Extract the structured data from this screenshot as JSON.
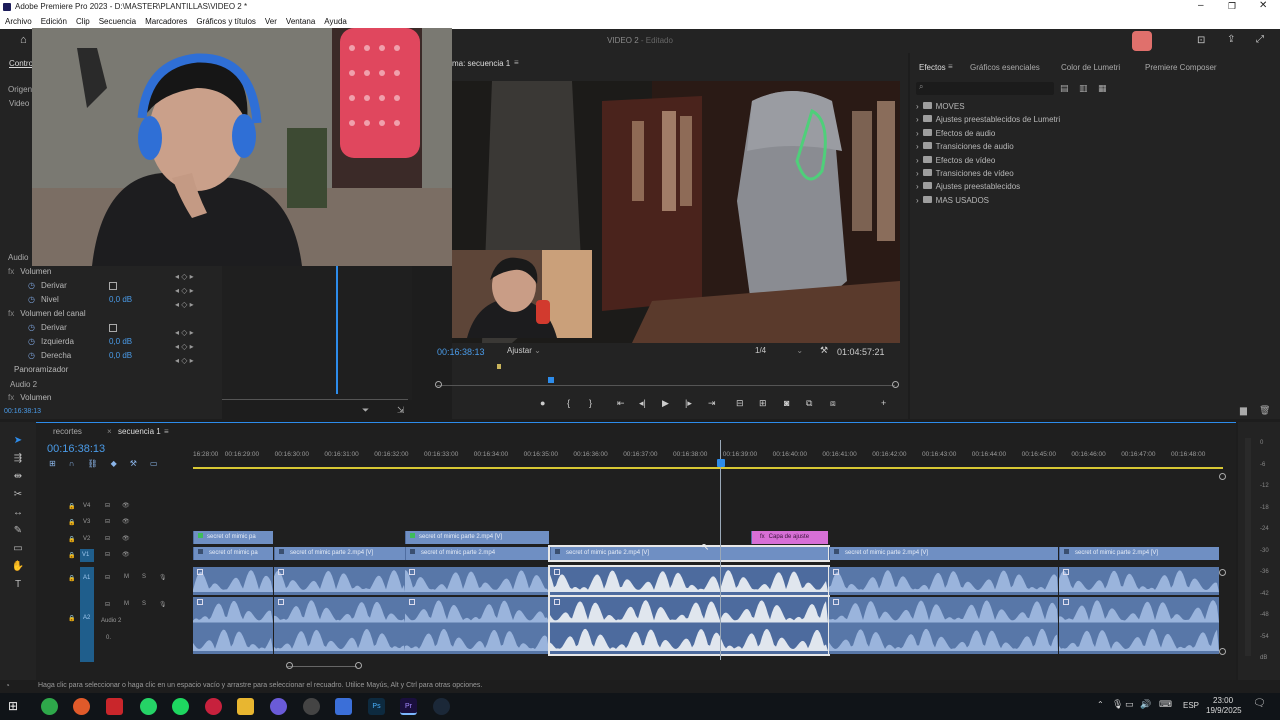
{
  "window": {
    "title": "Adobe Premiere Pro 2023 - D:\\MASTER\\PLANTILLAS\\VIDEO 2 *",
    "project": "VIDEO 2",
    "status": "Editado"
  },
  "menu": [
    "Archivo",
    "Edición",
    "Clip",
    "Secuencia",
    "Marcadores",
    "Gráficos y títulos",
    "Ver",
    "Ventana",
    "Ayuda"
  ],
  "left_panel": {
    "tab_controls": "Contro",
    "origen": "Origen",
    "video": "Video",
    "audio_section": "Audio",
    "audio2": "Audio 2",
    "rows": [
      {
        "label": "Volumen",
        "type": "fx"
      },
      {
        "label": "Derivar",
        "value": ""
      },
      {
        "label": "Nivel",
        "value": "0,0 dB"
      },
      {
        "label": "Volumen del canal",
        "type": "fx"
      },
      {
        "label": "Derivar",
        "value": ""
      },
      {
        "label": "Izquierda",
        "value": "0,0 dB"
      },
      {
        "label": "Derecha",
        "value": "0,0 dB"
      },
      {
        "label": "Panoramizador",
        "type": "fx"
      },
      {
        "label": "Volumen",
        "type": "fx2"
      }
    ],
    "timecode": "00:16:38:13"
  },
  "program": {
    "title": "ma: secuencia 1",
    "timecode": "00:16:38:13",
    "fit": "Ajustar",
    "resolution": "1/4",
    "duration": "01:04:57:21"
  },
  "effects": {
    "tabs": [
      "Efectos",
      "Gráficos esenciales",
      "Color de Lumetri",
      "Premiere Composer"
    ],
    "items": [
      "MOVES",
      "Ajustes preestablecidos de Lumetri",
      "Efectos de audio",
      "Transiciones de audio",
      "Efectos de vídeo",
      "Transiciones de vídeo",
      "Ajustes preestablecidos",
      "MAS USADOS"
    ]
  },
  "timeline": {
    "tabs": [
      "recortes",
      "secuencia 1"
    ],
    "timecode": "00:16:38:13",
    "ruler": [
      "16:28:00",
      "00:16:29:00",
      "00:16:30:00",
      "00:16:31:00",
      "00:16:32:00",
      "00:16:33:00",
      "00:16:34:00",
      "00:16:35:00",
      "00:16:36:00",
      "00:16:37:00",
      "00:16:38:00",
      "00:16:39:00",
      "00:16:40:00",
      "00:16:41:00",
      "00:16:42:00",
      "00:16:43:00",
      "00:16:44:00",
      "00:16:45:00",
      "00:16:46:00",
      "00:16:47:00",
      "00:16:48:00"
    ],
    "tracks": [
      "V4",
      "V3",
      "V2",
      "V1",
      "A1",
      "A2"
    ],
    "audio2_label": "Audio 2",
    "audio2_value": "0.",
    "clips_v2": [
      "secret of mimic pa",
      "secret of mimic parte 2.mp4 [V]",
      "Capa de ajuste"
    ],
    "clips_v1": [
      "secret of mimic pa",
      "secret of mimic parte 2.mp4 [V]",
      "secret of mimic parte 2.mp4",
      "secret of mimic parte 2.mp4 [V]",
      "secret of mimic parte 2.mp4 [V]",
      "secret of mimic parte 2.mp4 [V]"
    ],
    "meter": [
      "0",
      "-6",
      "-12",
      "-18",
      "-24",
      "-30",
      "-36",
      "-42",
      "-48",
      "-54",
      "dB"
    ]
  },
  "statusbar": "Haga clic para seleccionar o haga clic en un espacio vacío y arrastre para seleccionar el recuadro. Utilice Mayús, Alt y Ctrl para otras opciones.",
  "taskbar": {
    "lang": "ESP",
    "time": "23:00",
    "date": "19/9/2025"
  },
  "colors": {
    "accent": "#2d8ceb",
    "clip": "#6f8fc3",
    "adjust": "#d76fd6",
    "playhead": "#2d8ceb"
  }
}
